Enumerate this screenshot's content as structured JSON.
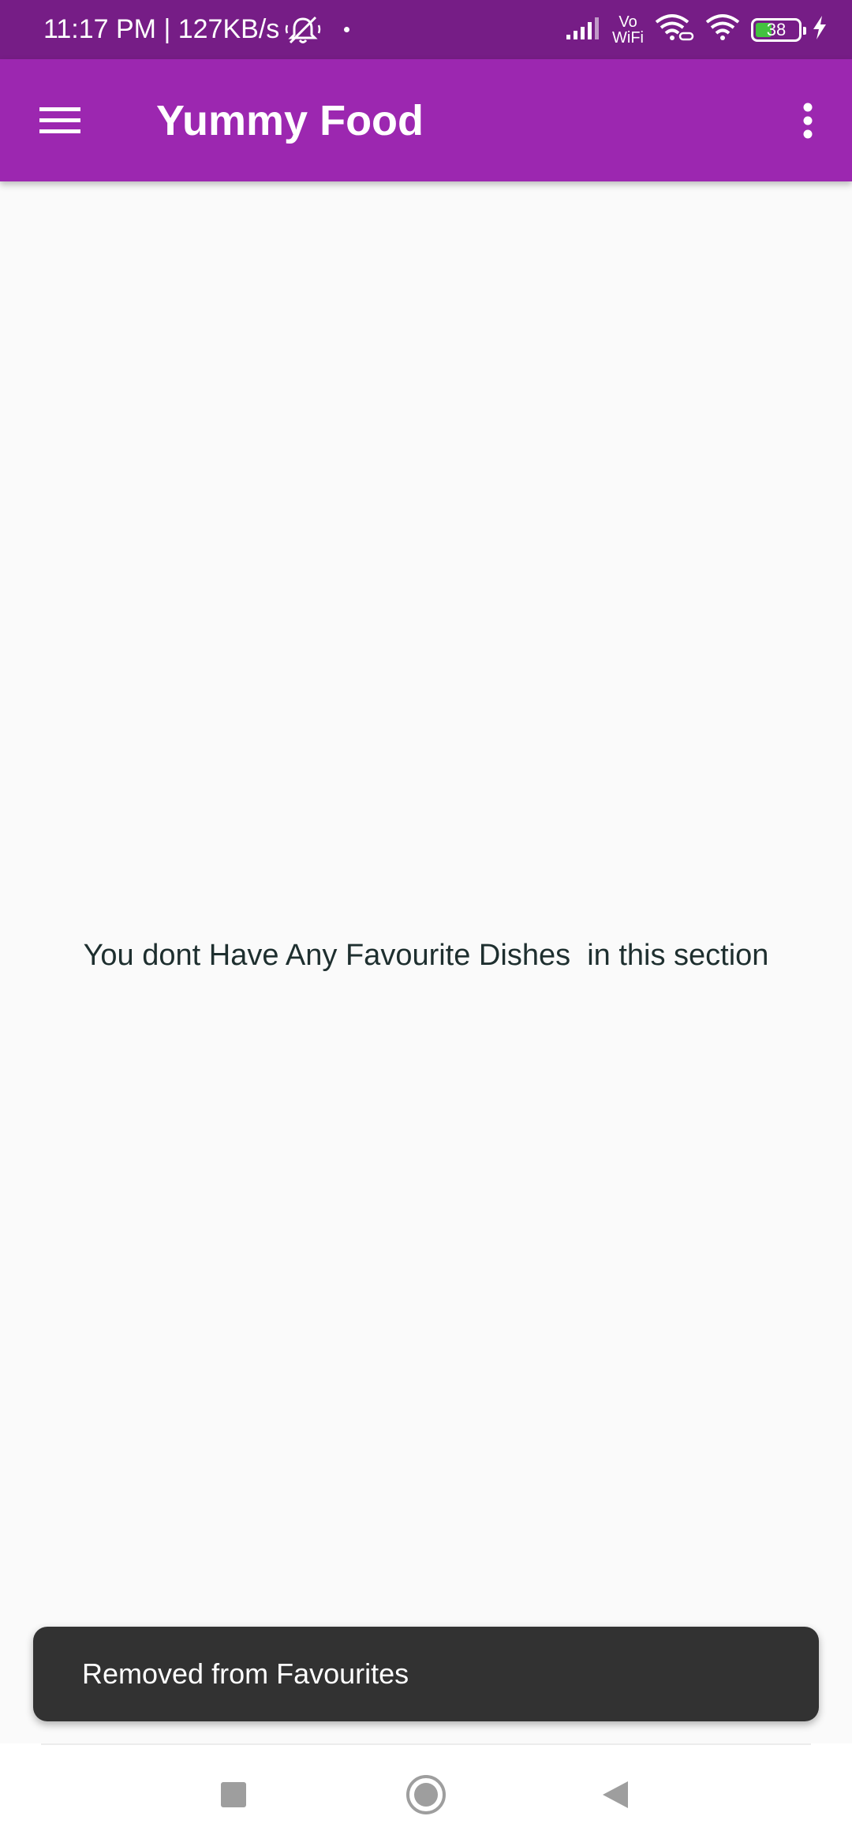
{
  "status_bar": {
    "time_and_speed": "11:17 PM | 127KB/s",
    "vowifi_top": "Vo",
    "vowifi_bottom": "WiFi",
    "battery_level": "38",
    "battery_fraction": 0.38,
    "background_color": "#761d86",
    "icons": [
      "bell-off-icon",
      "notification-dot-icon",
      "cellular-signal-icon",
      "vowifi-icon",
      "wifi-link-icon",
      "wifi-icon",
      "battery-icon",
      "charging-bolt-icon"
    ]
  },
  "app_bar": {
    "title": "Yummy Food",
    "background_color": "#9c27b0",
    "menu_icon": "hamburger-menu-icon",
    "overflow_icon": "more-vert-icon"
  },
  "main": {
    "empty_message": "You dont Have Any Favourite Dishes  in this section"
  },
  "snackbar": {
    "message": "Removed from Favourites"
  },
  "nav_bar": {
    "icons": [
      "recents-square-icon",
      "home-circle-icon",
      "back-triangle-icon"
    ]
  }
}
